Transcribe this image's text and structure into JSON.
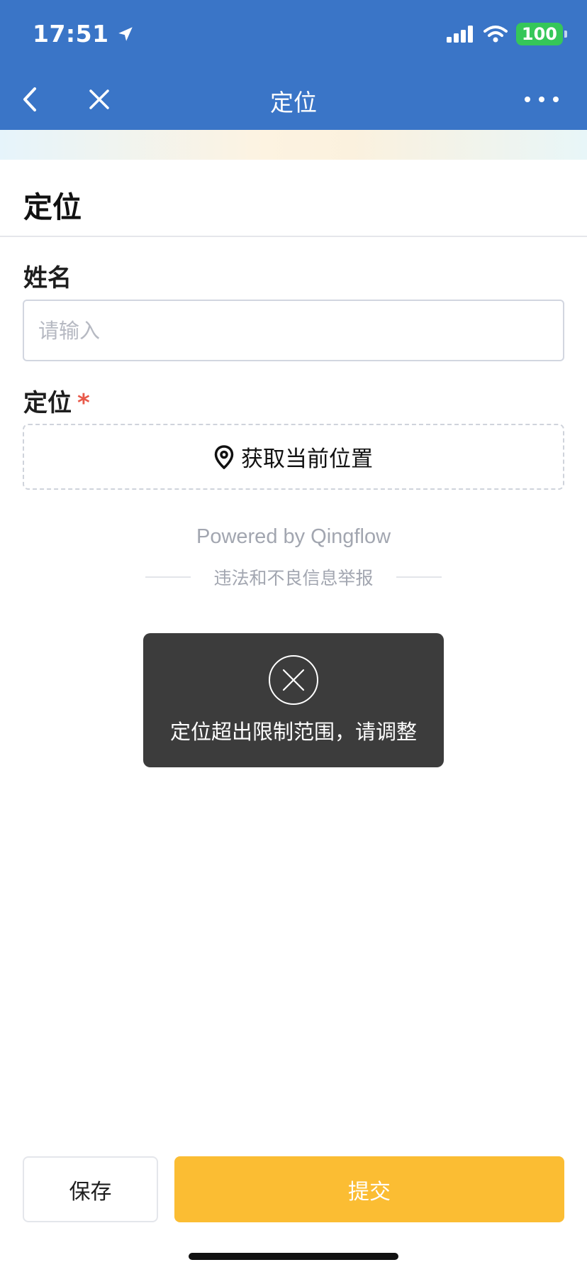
{
  "status_bar": {
    "time": "17:51",
    "battery": "100",
    "battery_color": "#35c759"
  },
  "nav": {
    "title": "定位",
    "back_icon": "chevron-left-icon",
    "close_icon": "close-icon",
    "more_icon": "more-icon",
    "background_color": "#3a75c7"
  },
  "form": {
    "title": "定位",
    "fields": [
      {
        "label": "姓名",
        "placeholder": "请输入",
        "value": ""
      },
      {
        "label": "定位",
        "required_mark": "*",
        "action_label": "获取当前位置",
        "action_icon": "location-pin-icon"
      }
    ]
  },
  "footer": {
    "powered_by": "Powered by Qingflow",
    "report_link": "违法和不良信息举报"
  },
  "toast": {
    "icon": "close-circle-icon",
    "message": "定位超出限制范围，请调整"
  },
  "actions": {
    "save_label": "保存",
    "submit_label": "提交",
    "submit_color": "#fbbd33"
  }
}
